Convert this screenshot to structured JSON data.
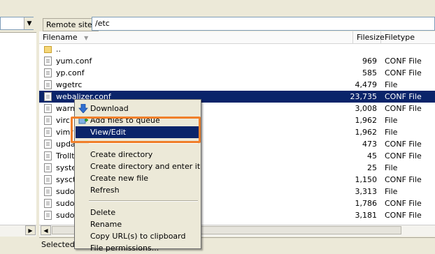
{
  "remote": {
    "label": "Remote site:",
    "path": "/etc"
  },
  "columns": {
    "filename": "Filename",
    "filesize": "Filesize",
    "filetype": "Filetype"
  },
  "files": [
    {
      "name": "..",
      "size": "",
      "type": "",
      "icon": "folder-up-icon"
    },
    {
      "name": "yum.conf",
      "size": "969",
      "type": "CONF File",
      "icon": "file-icon"
    },
    {
      "name": "yp.conf",
      "size": "585",
      "type": "CONF File",
      "icon": "file-icon"
    },
    {
      "name": "wgetrc",
      "size": "4,479",
      "type": "File",
      "icon": "file-icon"
    },
    {
      "name": "webalizer.conf",
      "size": "23,735",
      "type": "CONF File",
      "icon": "file-icon",
      "selected": true
    },
    {
      "name": "warnq",
      "size": "3,008",
      "type": "CONF File",
      "icon": "file-icon"
    },
    {
      "name": "virc",
      "size": "1,962",
      "type": "File",
      "icon": "file-icon"
    },
    {
      "name": "vimr",
      "size": "1,962",
      "type": "File",
      "icon": "file-icon"
    },
    {
      "name": "upda",
      "size": "473",
      "type": "CONF File",
      "icon": "file-icon"
    },
    {
      "name": "Trollt",
      "size": "45",
      "type": "CONF File",
      "icon": "file-icon"
    },
    {
      "name": "syste",
      "size": "25",
      "type": "File",
      "icon": "file-icon"
    },
    {
      "name": "sysctl",
      "size": "1,150",
      "type": "CONF File",
      "icon": "file-icon"
    },
    {
      "name": "sudoe",
      "size": "3,313",
      "type": "File",
      "icon": "file-icon"
    },
    {
      "name": "sudo.",
      "size": "1,786",
      "type": "CONF File",
      "icon": "file-icon"
    },
    {
      "name": "sudo-",
      "size": "3,181",
      "type": "CONF File",
      "icon": "file-icon"
    }
  ],
  "context_menu": {
    "items": [
      {
        "label": "Download",
        "icon": "download-arrow-icon"
      },
      {
        "label": "Add files to queue",
        "icon": "add-queue-icon"
      },
      {
        "label": "View/Edit",
        "highlighted": true
      },
      {
        "separator": true
      },
      {
        "label": "Create directory"
      },
      {
        "label": "Create directory and enter it"
      },
      {
        "label": "Create new file"
      },
      {
        "label": "Refresh"
      },
      {
        "separator": true
      },
      {
        "label": "Delete"
      },
      {
        "label": "Rename"
      },
      {
        "label": "Copy URL(s) to clipboard"
      },
      {
        "label": "File permissions..."
      }
    ]
  },
  "status": {
    "text": "Selected"
  },
  "colors": {
    "selection": "#0a246a",
    "highlight_box": "#f07f2a"
  }
}
